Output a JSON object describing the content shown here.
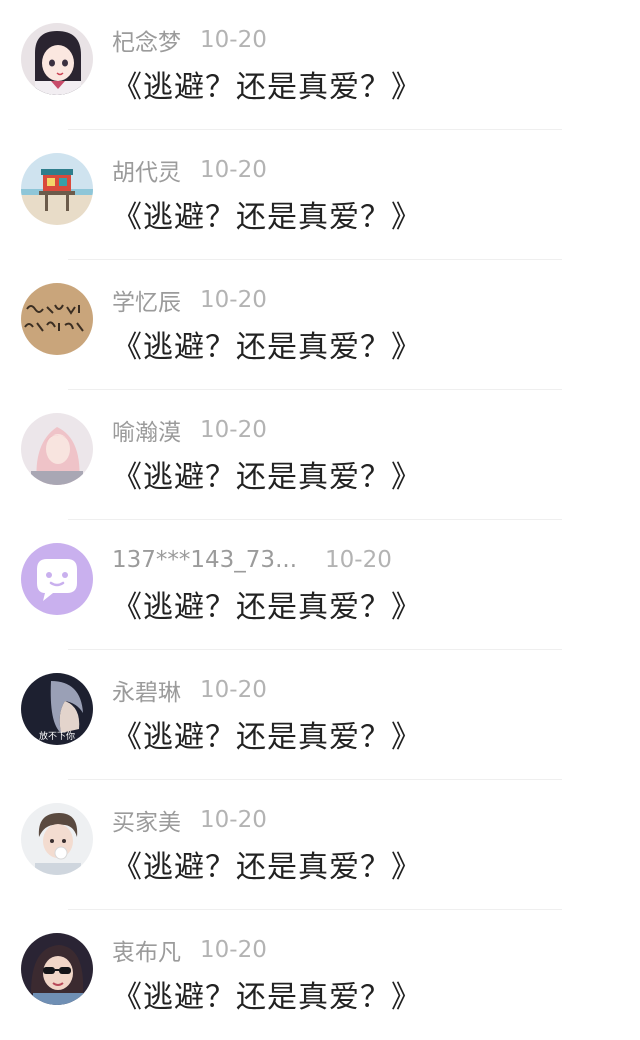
{
  "comments": [
    {
      "name": "杞念梦",
      "date": "10-20",
      "text": "《逃避？还是真爱？》",
      "avatar": "anime-girl-avatar"
    },
    {
      "name": "胡代灵",
      "date": "10-20",
      "text": "《逃避？还是真爱？》",
      "avatar": "lifeguard-hut-avatar"
    },
    {
      "name": "学忆辰",
      "date": "10-20",
      "text": "《逃避？还是真爱？》",
      "avatar": "handwriting-avatar"
    },
    {
      "name": "喻瀚漠",
      "date": "10-20",
      "text": "《逃避？还是真爱？》",
      "avatar": "pink-hair-girl-avatar"
    },
    {
      "name": "137***143_73...",
      "date": "10-20",
      "text": "《逃避？还是真爱？》",
      "avatar": "default-chat-bubble-avatar"
    },
    {
      "name": "永碧琳",
      "date": "10-20",
      "text": "《逃避？还是真爱？》",
      "avatar": "dark-photo-avatar",
      "avatar_caption": "放不下你"
    },
    {
      "name": "买家美",
      "date": "10-20",
      "text": "《逃避？还是真爱？》",
      "avatar": "young-man-avatar"
    },
    {
      "name": "衷布凡",
      "date": "10-20",
      "text": "《逃避？还是真爱？》",
      "avatar": "sunglasses-girl-avatar"
    }
  ],
  "colors": {
    "name": "#9b9b9b",
    "date": "#b3b3b3",
    "text": "#222222",
    "default_avatar_bg": "#c9b0ee",
    "divider": "#efefef"
  }
}
